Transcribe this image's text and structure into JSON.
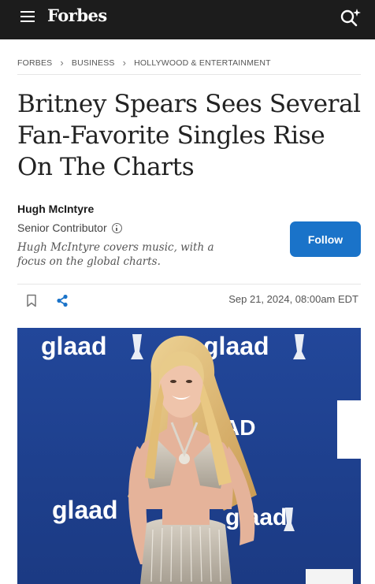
{
  "header": {
    "brand": "Forbes",
    "menu_icon": "hamburger-menu-icon",
    "search_icon": "search-sparkle-icon"
  },
  "breadcrumb": [
    "FORBES",
    "BUSINESS",
    "HOLLYWOOD & ENTERTAINMENT"
  ],
  "article": {
    "headline": "Britney Spears Sees Several Fan-Favorite Singles Rise On The Charts",
    "author_name": "Hugh McIntyre",
    "author_role": "Senior Contributor",
    "author_bio": "Hugh McIntyre covers music, with a focus on the global charts.",
    "follow_label": "Follow",
    "date": "Sep 21, 2024, 08:00am EDT"
  },
  "hero_image": {
    "backdrop_text": [
      "glaad",
      "glaad",
      "AD",
      "glaad",
      "glaad"
    ],
    "backdrop_color": "#1f3f8e"
  },
  "colors": {
    "header_bg": "#1c1c1c",
    "follow_button": "#1a73c9",
    "share_icon": "#1a73c9"
  }
}
